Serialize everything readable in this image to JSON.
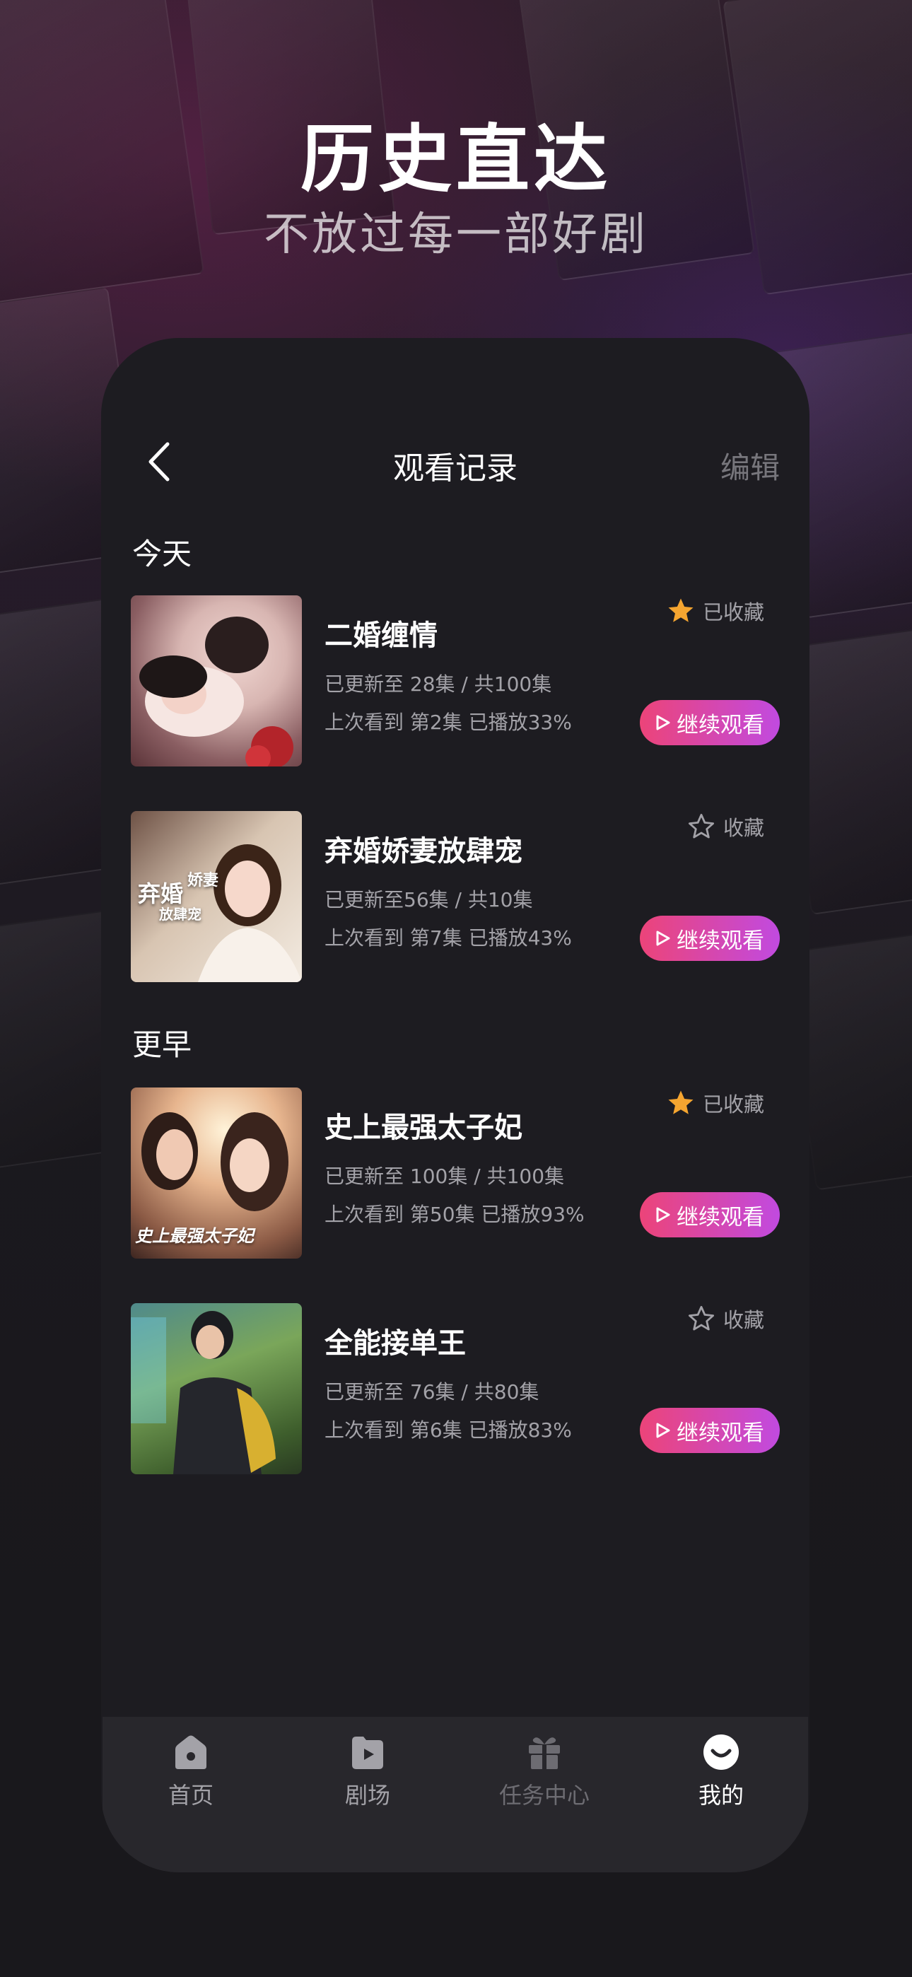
{
  "hero": {
    "title": "历史直达",
    "subtitle": "不放过每一部好剧"
  },
  "nav": {
    "title": "观看记录",
    "edit_label": "编辑",
    "back_icon": "chevron-left-icon"
  },
  "sections": [
    {
      "label": "今天",
      "items": [
        {
          "title": "二婚缠情",
          "update": "已更新至 28集 / 共100集",
          "progress": "上次看到 第2集 已播放33%",
          "favorited": true,
          "fav_label": "已收藏",
          "continue_label": "继续观看"
        },
        {
          "title": "弃婚娇妻放肆宠",
          "update": "已更新至56集 / 共10集",
          "progress": "上次看到 第7集 已播放43%",
          "favorited": false,
          "fav_label": "收藏",
          "continue_label": "继续观看",
          "poster_text": [
            "弃婚",
            "娇妻",
            "放肆宠"
          ]
        }
      ]
    },
    {
      "label": "更早",
      "items": [
        {
          "title": "史上最强太子妃",
          "update": "已更新至 100集 / 共100集",
          "progress": "上次看到 第50集 已播放93%",
          "favorited": true,
          "fav_label": "已收藏",
          "continue_label": "继续观看",
          "poster_text": [
            "史上最强太子妃"
          ]
        },
        {
          "title": "全能接单王",
          "update": "已更新至 76集 / 共80集",
          "progress": "上次看到 第6集 已播放83%",
          "favorited": false,
          "fav_label": "收藏",
          "continue_label": "继续观看"
        }
      ]
    }
  ],
  "tabbar": [
    {
      "label": "首页",
      "icon": "home-icon",
      "active": false,
      "color": "#a3a2a8"
    },
    {
      "label": "剧场",
      "icon": "play-square-icon",
      "active": false,
      "color": "#a3a2a8"
    },
    {
      "label": "任务中心",
      "icon": "gift-icon",
      "active": false,
      "color": "#6d6c72"
    },
    {
      "label": "我的",
      "icon": "profile-face-icon",
      "active": true,
      "color": "#ffffff"
    }
  ],
  "colors": {
    "accent_gradient_start": "#ec4479",
    "accent_gradient_end": "#c14ae0",
    "star_filled": "#f5a530",
    "background": "#19181c",
    "panel": "#1d1c21"
  }
}
